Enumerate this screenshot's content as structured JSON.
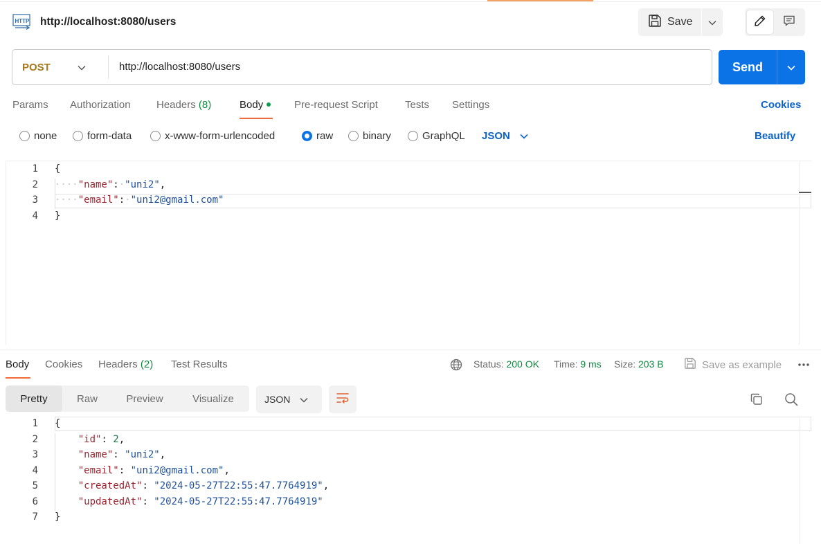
{
  "header": {
    "title": "http://localhost:8080/users",
    "save_label": "Save",
    "icons": [
      "http-icon",
      "save-icon",
      "chevron-down-icon",
      "pencil-icon",
      "comment-icon"
    ]
  },
  "request": {
    "method": "POST",
    "url": "http://localhost:8080/users",
    "send_label": "Send",
    "tabs": {
      "params": "Params",
      "authorization": "Authorization",
      "headers": "Headers",
      "headers_count": "(8)",
      "body": "Body",
      "prerequest": "Pre-request Script",
      "tests": "Tests",
      "settings": "Settings"
    },
    "cookies_link": "Cookies",
    "body_types": {
      "none": "none",
      "form_data": "form-data",
      "urlencoded": "x-www-form-urlencoded",
      "raw": "raw",
      "binary": "binary",
      "graphql": "GraphQL"
    },
    "selected_body_type": "raw",
    "language": "JSON",
    "beautify": "Beautify",
    "body_lines": [
      {
        "n": "1",
        "text": "{"
      },
      {
        "n": "2",
        "key": "\"name\"",
        "value": "\"uni2\"",
        "trail": ","
      },
      {
        "n": "3",
        "key": "\"email\"",
        "value": "\"uni2@gmail.com\"",
        "trail": ""
      },
      {
        "n": "4",
        "text": "}"
      }
    ]
  },
  "response": {
    "tabs": {
      "body": "Body",
      "cookies": "Cookies",
      "headers": "Headers",
      "headers_count": "(2)",
      "test_results": "Test Results"
    },
    "status_label": "Status:",
    "status_value": "200 OK",
    "time_label": "Time:",
    "time_value": "9 ms",
    "size_label": "Size:",
    "size_value": "203 B",
    "save_example": "Save as example",
    "views": {
      "pretty": "Pretty",
      "raw": "Raw",
      "preview": "Preview",
      "visualize": "Visualize"
    },
    "language": "JSON",
    "body_lines": [
      {
        "n": "1",
        "text": "{"
      },
      {
        "n": "2",
        "key": "\"id\"",
        "num": "2",
        "trail": ","
      },
      {
        "n": "3",
        "key": "\"name\"",
        "value": "\"uni2\"",
        "trail": ","
      },
      {
        "n": "4",
        "key": "\"email\"",
        "value": "\"uni2@gmail.com\"",
        "trail": ","
      },
      {
        "n": "5",
        "key": "\"createdAt\"",
        "value": "\"2024-05-27T22:55:47.7764919\"",
        "trail": ","
      },
      {
        "n": "6",
        "key": "\"updatedAt\"",
        "value": "\"2024-05-27T22:55:47.7764919\"",
        "trail": ""
      },
      {
        "n": "7",
        "text": "}"
      }
    ]
  },
  "colors": {
    "accent_blue": "#0b73e6",
    "method_post": "#a8771d",
    "tab_underline": "#f26b3a",
    "status_green": "#0c8a3e"
  }
}
